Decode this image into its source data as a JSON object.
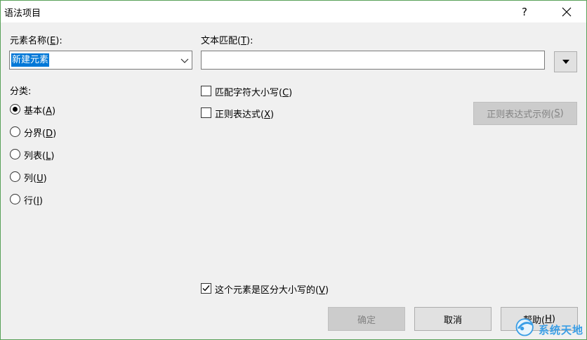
{
  "window": {
    "title": "语法项目",
    "help_label": "?",
    "close_icon": "close-icon"
  },
  "element_name": {
    "label": "元素名称(",
    "mnemonic": "E",
    "label_end": "):",
    "value": "新建元素"
  },
  "text_match": {
    "label": "文本匹配(",
    "mnemonic": "T",
    "label_end": "):",
    "value": ""
  },
  "category": {
    "label": "分类:",
    "options": [
      {
        "text": "基本(",
        "mn": "A",
        "end": ")",
        "checked": true
      },
      {
        "text": "分界(",
        "mn": "D",
        "end": ")",
        "checked": false
      },
      {
        "text": "列表(",
        "mn": "L",
        "end": ")",
        "checked": false
      },
      {
        "text": "列(",
        "mn": "U",
        "end": ")",
        "checked": false
      },
      {
        "text": "行(",
        "mn": "I",
        "end": ")",
        "checked": false
      }
    ]
  },
  "options": {
    "match_case": {
      "text": "匹配字符大小写(",
      "mn": "C",
      "end": ")",
      "checked": false
    },
    "regex": {
      "text": "正则表达式(",
      "mn": "X",
      "end": ")",
      "checked": false
    },
    "case_sensitive": {
      "text": "这个元素是区分大小写的(",
      "mn": "V",
      "end": ")",
      "checked": true
    }
  },
  "buttons": {
    "regex_example": {
      "text": "正则表达式示例(",
      "mn": "S",
      "end": ")"
    },
    "ok": "确定",
    "cancel": "取消",
    "help": {
      "text": "帮助(",
      "mn": "H",
      "end": ")"
    }
  },
  "watermark": {
    "text": "系统天地"
  }
}
